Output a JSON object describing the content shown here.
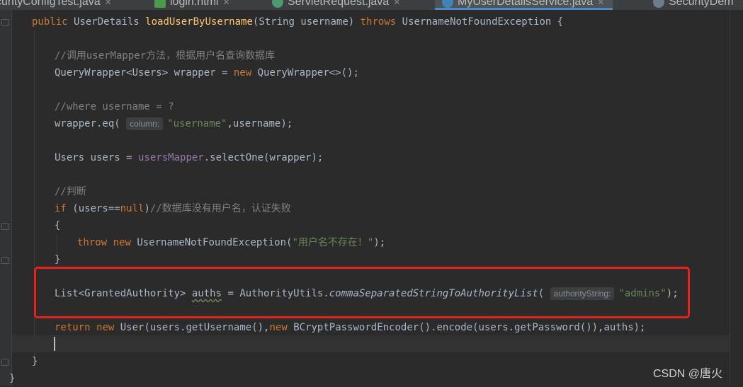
{
  "tabs": [
    {
      "label": "curityConfigTest.java",
      "active": false
    },
    {
      "label": "login.html",
      "active": false
    },
    {
      "label": "ServletRequest.java",
      "active": false
    },
    {
      "label": "MyUserDetailsService.java",
      "active": true
    },
    {
      "label": "SecurityDem",
      "active": false
    }
  ],
  "code": {
    "sig_kw": "public",
    "sig_type": "UserDetails",
    "sig_method": "loadUserByUsername",
    "sig_params": "(String username)",
    "sig_throws": "throws",
    "sig_exc": "UsernameNotFoundException {",
    "c1": "//调用userMapper方法，根据用户名查询数据库",
    "l2_a": "QueryWrapper<Users> wrapper = ",
    "l2_new": "new",
    "l2_b": " QueryWrapper<>();",
    "c2": "//where username = ?",
    "l3_a": "wrapper.eq(",
    "l3_hint": "column:",
    "l3_str": "\"username\"",
    "l3_b": ",username);",
    "l4_a": "Users users = ",
    "l4_field": "usersMapper",
    "l4_b": ".selectOne(wrapper);",
    "c3": "//判断",
    "l5_if": "if",
    "l5_a": " (users==",
    "l5_null": "null",
    "l5_b": ")",
    "l5_cm": "//数据库没有用户名，认证失败",
    "l6": "{",
    "l7_throw": "throw",
    "l7_new": "new",
    "l7_a": " UsernameNotFoundException(",
    "l7_str": "\"用户名不存在！\"",
    "l7_b": ");",
    "l8": "}",
    "l9_a": "List<GrantedAuthority> ",
    "l9_var": "auths",
    "l9_b": " = AuthorityUtils.",
    "l9_method": "commaSeparatedStringToAuthorityList",
    "l9_c": "(",
    "l9_hint": "authorityString:",
    "l9_str": "\"admins\"",
    "l9_d": ");",
    "l10_ret": "return",
    "l10_new": "new",
    "l10_a": " User(users.getUsername(),",
    "l10_new2": "new",
    "l10_b": " BCryptPasswordEncoder().encode(users.getPassword()),auths);",
    "l11": "}",
    "l12": "}"
  },
  "watermark": "CSDN @唐火",
  "colors": {
    "background": "#2b2b2b",
    "keyword": "#cc7832",
    "method_decl": "#ffc66d",
    "string": "#6a8759",
    "comment": "#808080",
    "field": "#9876aa",
    "highlight_box": "#e8221b"
  }
}
